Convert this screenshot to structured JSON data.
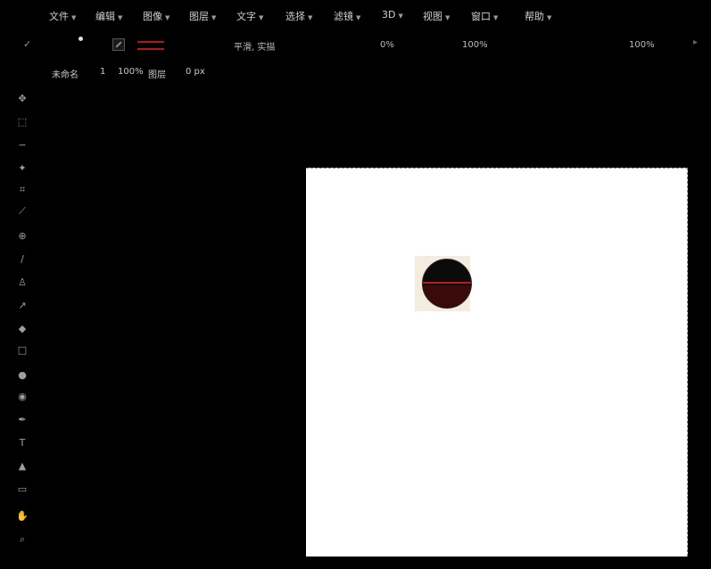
{
  "menu": {
    "items": [
      {
        "label": "文件",
        "icon": "chevron-down-icon"
      },
      {
        "label": "编辑",
        "icon": "chevron-down-icon"
      },
      {
        "label": "图像",
        "icon": "chevron-down-icon"
      },
      {
        "label": "图层",
        "icon": "chevron-down-icon"
      },
      {
        "label": "文字",
        "icon": "chevron-down-icon"
      },
      {
        "label": "选择",
        "icon": "chevron-down-icon"
      },
      {
        "label": "滤镜",
        "icon": "chevron-down-icon"
      },
      {
        "label": "3D",
        "icon": "chevron-down-icon"
      },
      {
        "label": "视图",
        "icon": "chevron-down-icon"
      },
      {
        "label": "窗口",
        "icon": "chevron-down-icon"
      },
      {
        "label": "帮助",
        "icon": "chevron-down-icon"
      }
    ]
  },
  "options": {
    "mode_label": "平滑, 实描",
    "value1": "0%",
    "value2": "100%",
    "value3": "100%",
    "stroke_color": "#b01818"
  },
  "options2": {
    "label_a": "未命名",
    "label_b": "1",
    "label_c": "100%",
    "label_d": "图层",
    "label_e": "0 px"
  },
  "toolbar": {
    "tools": [
      "move-icon",
      "marquee-icon",
      "lasso-icon",
      "magic-wand-icon",
      "crop-icon",
      "eyedropper-icon",
      "healing-icon",
      "brush-icon",
      "stamp-icon",
      "history-brush-icon",
      "eraser-icon",
      "gradient-icon",
      "blur-icon",
      "dodge-icon",
      "pen-icon",
      "text-icon",
      "path-select-icon",
      "shape-icon",
      "hand-icon",
      "zoom-icon"
    ]
  },
  "canvas": {
    "background": "#ffffff",
    "shape_fill": "#0b0b0b",
    "shape_stroke": "#c01a1a"
  }
}
